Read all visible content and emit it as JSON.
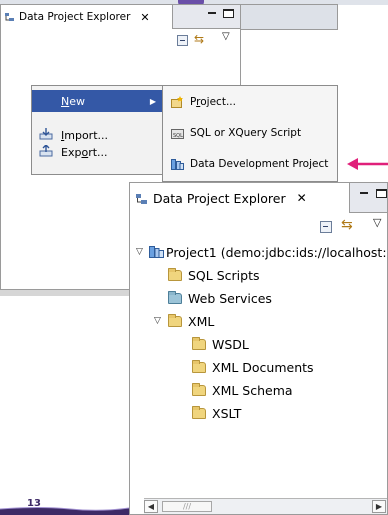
{
  "back_view": {
    "tab_title": "Data Project Explorer",
    "tab_close": "✕"
  },
  "context_menu": {
    "items": [
      {
        "label": "New",
        "mnemonic": "N",
        "rest": "ew",
        "has_submenu": true,
        "selected": true
      },
      {
        "label": "Import...",
        "mnemonic": "I",
        "rest": "mport..."
      },
      {
        "label": "Export...",
        "pre": "Exp",
        "mnemonic": "o",
        "rest": "rt..."
      }
    ]
  },
  "submenu": {
    "items": [
      {
        "label": "Project...",
        "pre": "P",
        "mnemonic": "r",
        "rest": "oject...",
        "icon": "new-project-icon"
      },
      {
        "label": "SQL or XQuery Script",
        "icon": "sql-script-icon"
      },
      {
        "label": "Data Development Project",
        "icon": "data-dev-project-icon"
      }
    ]
  },
  "front_view": {
    "tab_title": "Data Project Explorer",
    "tab_close": "✕",
    "tree": {
      "project": "Project1 (demo:jdbc:ids://localhost:",
      "children": [
        {
          "label": "SQL Scripts"
        },
        {
          "label": "Web Services"
        },
        {
          "label": "XML",
          "children": [
            "WSDL",
            "XML Documents",
            "XML Schema",
            "XSLT"
          ]
        }
      ]
    }
  },
  "footer": {
    "page_number": "13"
  },
  "colors": {
    "accent_arrow": "#e0207a",
    "menu_selection": "#3458a6",
    "folder": "#f0d57e"
  }
}
